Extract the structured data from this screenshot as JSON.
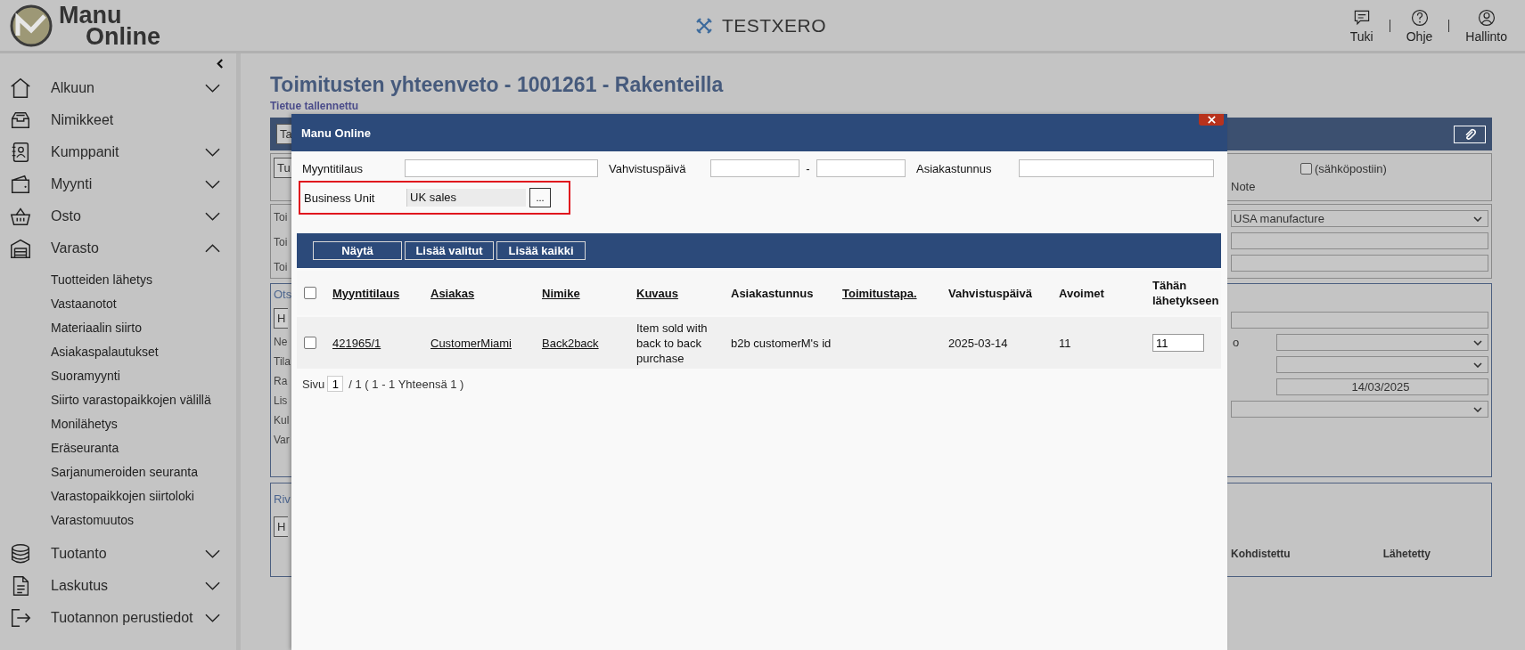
{
  "header": {
    "logo": {
      "line1": "Manu",
      "line2": "Online"
    },
    "brand": "TESTXERO",
    "actions": [
      {
        "label": "Tuki"
      },
      {
        "label": "Ohje"
      },
      {
        "label": "Hallinto"
      }
    ]
  },
  "sidebar": {
    "items": [
      {
        "label": "Alkuun",
        "expanded": false
      },
      {
        "label": "Nimikkeet"
      },
      {
        "label": "Kumppanit",
        "expanded": false
      },
      {
        "label": "Myynti",
        "expanded": false
      },
      {
        "label": "Osto",
        "expanded": false
      },
      {
        "label": "Varasto",
        "expanded": true,
        "children": [
          {
            "label": "Tuotteiden lähetys"
          },
          {
            "label": "Vastaanotot"
          },
          {
            "label": "Materiaalin siirto"
          },
          {
            "label": "Asiakaspalautukset"
          },
          {
            "label": "Suoramyynti"
          },
          {
            "label": "Siirto varastopaikkojen välillä"
          },
          {
            "label": "Monilähetys"
          },
          {
            "label": "Eräseuranta"
          },
          {
            "label": "Sarjanumeroiden seuranta"
          },
          {
            "label": "Varastopaikkojen siirtoloki"
          },
          {
            "label": "Varastomuutos"
          }
        ]
      },
      {
        "label": "Tuotanto",
        "expanded": false
      },
      {
        "label": "Laskutus",
        "expanded": false
      },
      {
        "label": "Tuotannon perustiedot",
        "expanded": false
      }
    ]
  },
  "page": {
    "title": "Toimitusten yhteenveto - 1001261 - Rakenteilla",
    "notice": "Tietue tallennettu",
    "toolbar": {
      "button": "Ta"
    },
    "panel_1": {
      "button": "Tu",
      "email_checkbox": {
        "label": "(sähköpostiin)",
        "checked": false
      },
      "note_label": "Note"
    },
    "panel_2": {
      "labels": [
        "Toi",
        "Toi",
        "Toi"
      ],
      "select": "USA manufacture"
    },
    "panel_3": {
      "legend": "Ots",
      "button": "H",
      "labels": [
        "Ne",
        "Tila",
        "Ra",
        "Lis",
        "Kul",
        "Var"
      ],
      "label_right": "o",
      "date": "14/03/2025"
    },
    "panel_4": {
      "legend": "Riv",
      "button": "H",
      "columns": [
        "Kohdistettu",
        "Lähetetty"
      ]
    }
  },
  "dialog": {
    "title": "Manu Online",
    "filters": {
      "order_label": "Myyntitilaus",
      "date_label": "Vahvistuspäivä",
      "range_separator": "-",
      "customer_label": "Asiakastunnus"
    },
    "business_unit": {
      "label": "Business Unit",
      "value": "UK sales",
      "browse": "...",
      "highlighted": true
    },
    "actions": [
      "Näytä",
      "Lisää valitut",
      "Lisää kaikki"
    ],
    "table": {
      "select_all": {
        "checked": false
      },
      "columns": [
        {
          "label": "Myyntitilaus",
          "sortable": true
        },
        {
          "label": "Asiakas",
          "sortable": true
        },
        {
          "label": "Nimike",
          "sortable": true
        },
        {
          "label": "Kuvaus",
          "sortable": true
        },
        {
          "label": "Asiakastunnus",
          "sortable": false
        },
        {
          "label": "Toimitustapa.",
          "sortable": true
        },
        {
          "label": "Vahvistuspäivä",
          "sortable": false
        },
        {
          "label": "Avoimet",
          "sortable": false
        },
        {
          "label": "Tähän lähetykseen",
          "sortable": false
        }
      ],
      "rows": [
        {
          "selected": false,
          "order": "421965/1",
          "customer": "CustomerMiami",
          "item": "Back2back",
          "description": "Item sold with back to back purchase",
          "customer_id": "b2b customerM's id",
          "confirm_date": "2025-03-14",
          "open": "11",
          "to_ship": "11"
        }
      ]
    },
    "pager": {
      "prefix": "Sivu",
      "page": "1",
      "summary": "/ 1 ( 1 - 1 Yhteensä 1 )"
    }
  }
}
